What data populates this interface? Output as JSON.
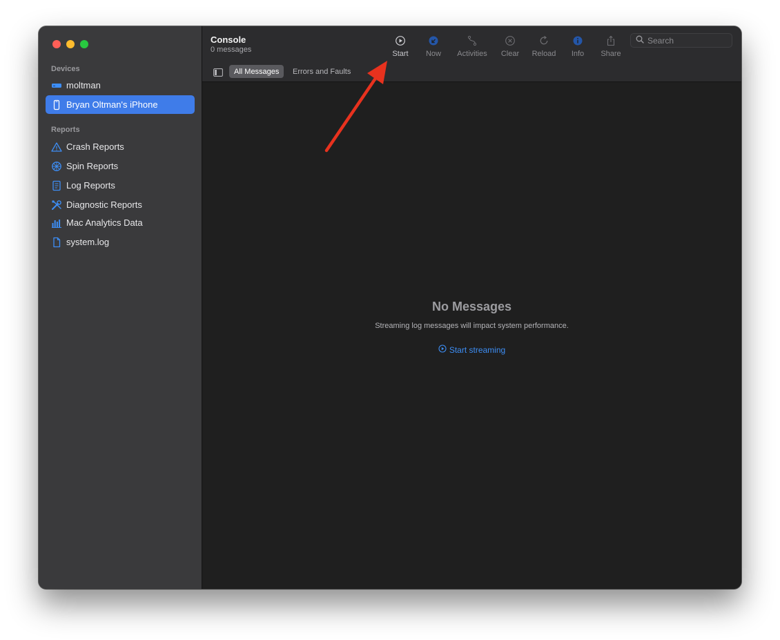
{
  "window": {
    "title": "Console",
    "subtitle": "0 messages"
  },
  "sidebar": {
    "devices_title": "Devices",
    "devices": [
      {
        "label": "moltman",
        "icon": "mac-mini-icon"
      },
      {
        "label": "Bryan Oltman's iPhone",
        "icon": "iphone-icon",
        "selected": true
      }
    ],
    "reports_title": "Reports",
    "reports": [
      {
        "label": "Crash Reports",
        "icon": "warning-triangle-icon"
      },
      {
        "label": "Spin Reports",
        "icon": "spin-wheel-icon"
      },
      {
        "label": "Log Reports",
        "icon": "document-list-icon"
      },
      {
        "label": "Diagnostic Reports",
        "icon": "tools-icon"
      },
      {
        "label": "Mac Analytics Data",
        "icon": "bar-chart-icon"
      },
      {
        "label": "system.log",
        "icon": "file-icon"
      }
    ]
  },
  "toolbar": {
    "start": "Start",
    "now": "Now",
    "activities": "Activities",
    "clear": "Clear",
    "reload": "Reload",
    "info": "Info",
    "share": "Share",
    "search_placeholder": "Search"
  },
  "filters": {
    "all": "All Messages",
    "errors": "Errors and Faults"
  },
  "empty_state": {
    "title": "No Messages",
    "description": "Streaming log messages will impact system performance.",
    "link": "Start streaming"
  },
  "colors": {
    "accent": "#3f7ce9",
    "link": "#3d8ef5",
    "annotation_arrow": "#e8321e"
  }
}
